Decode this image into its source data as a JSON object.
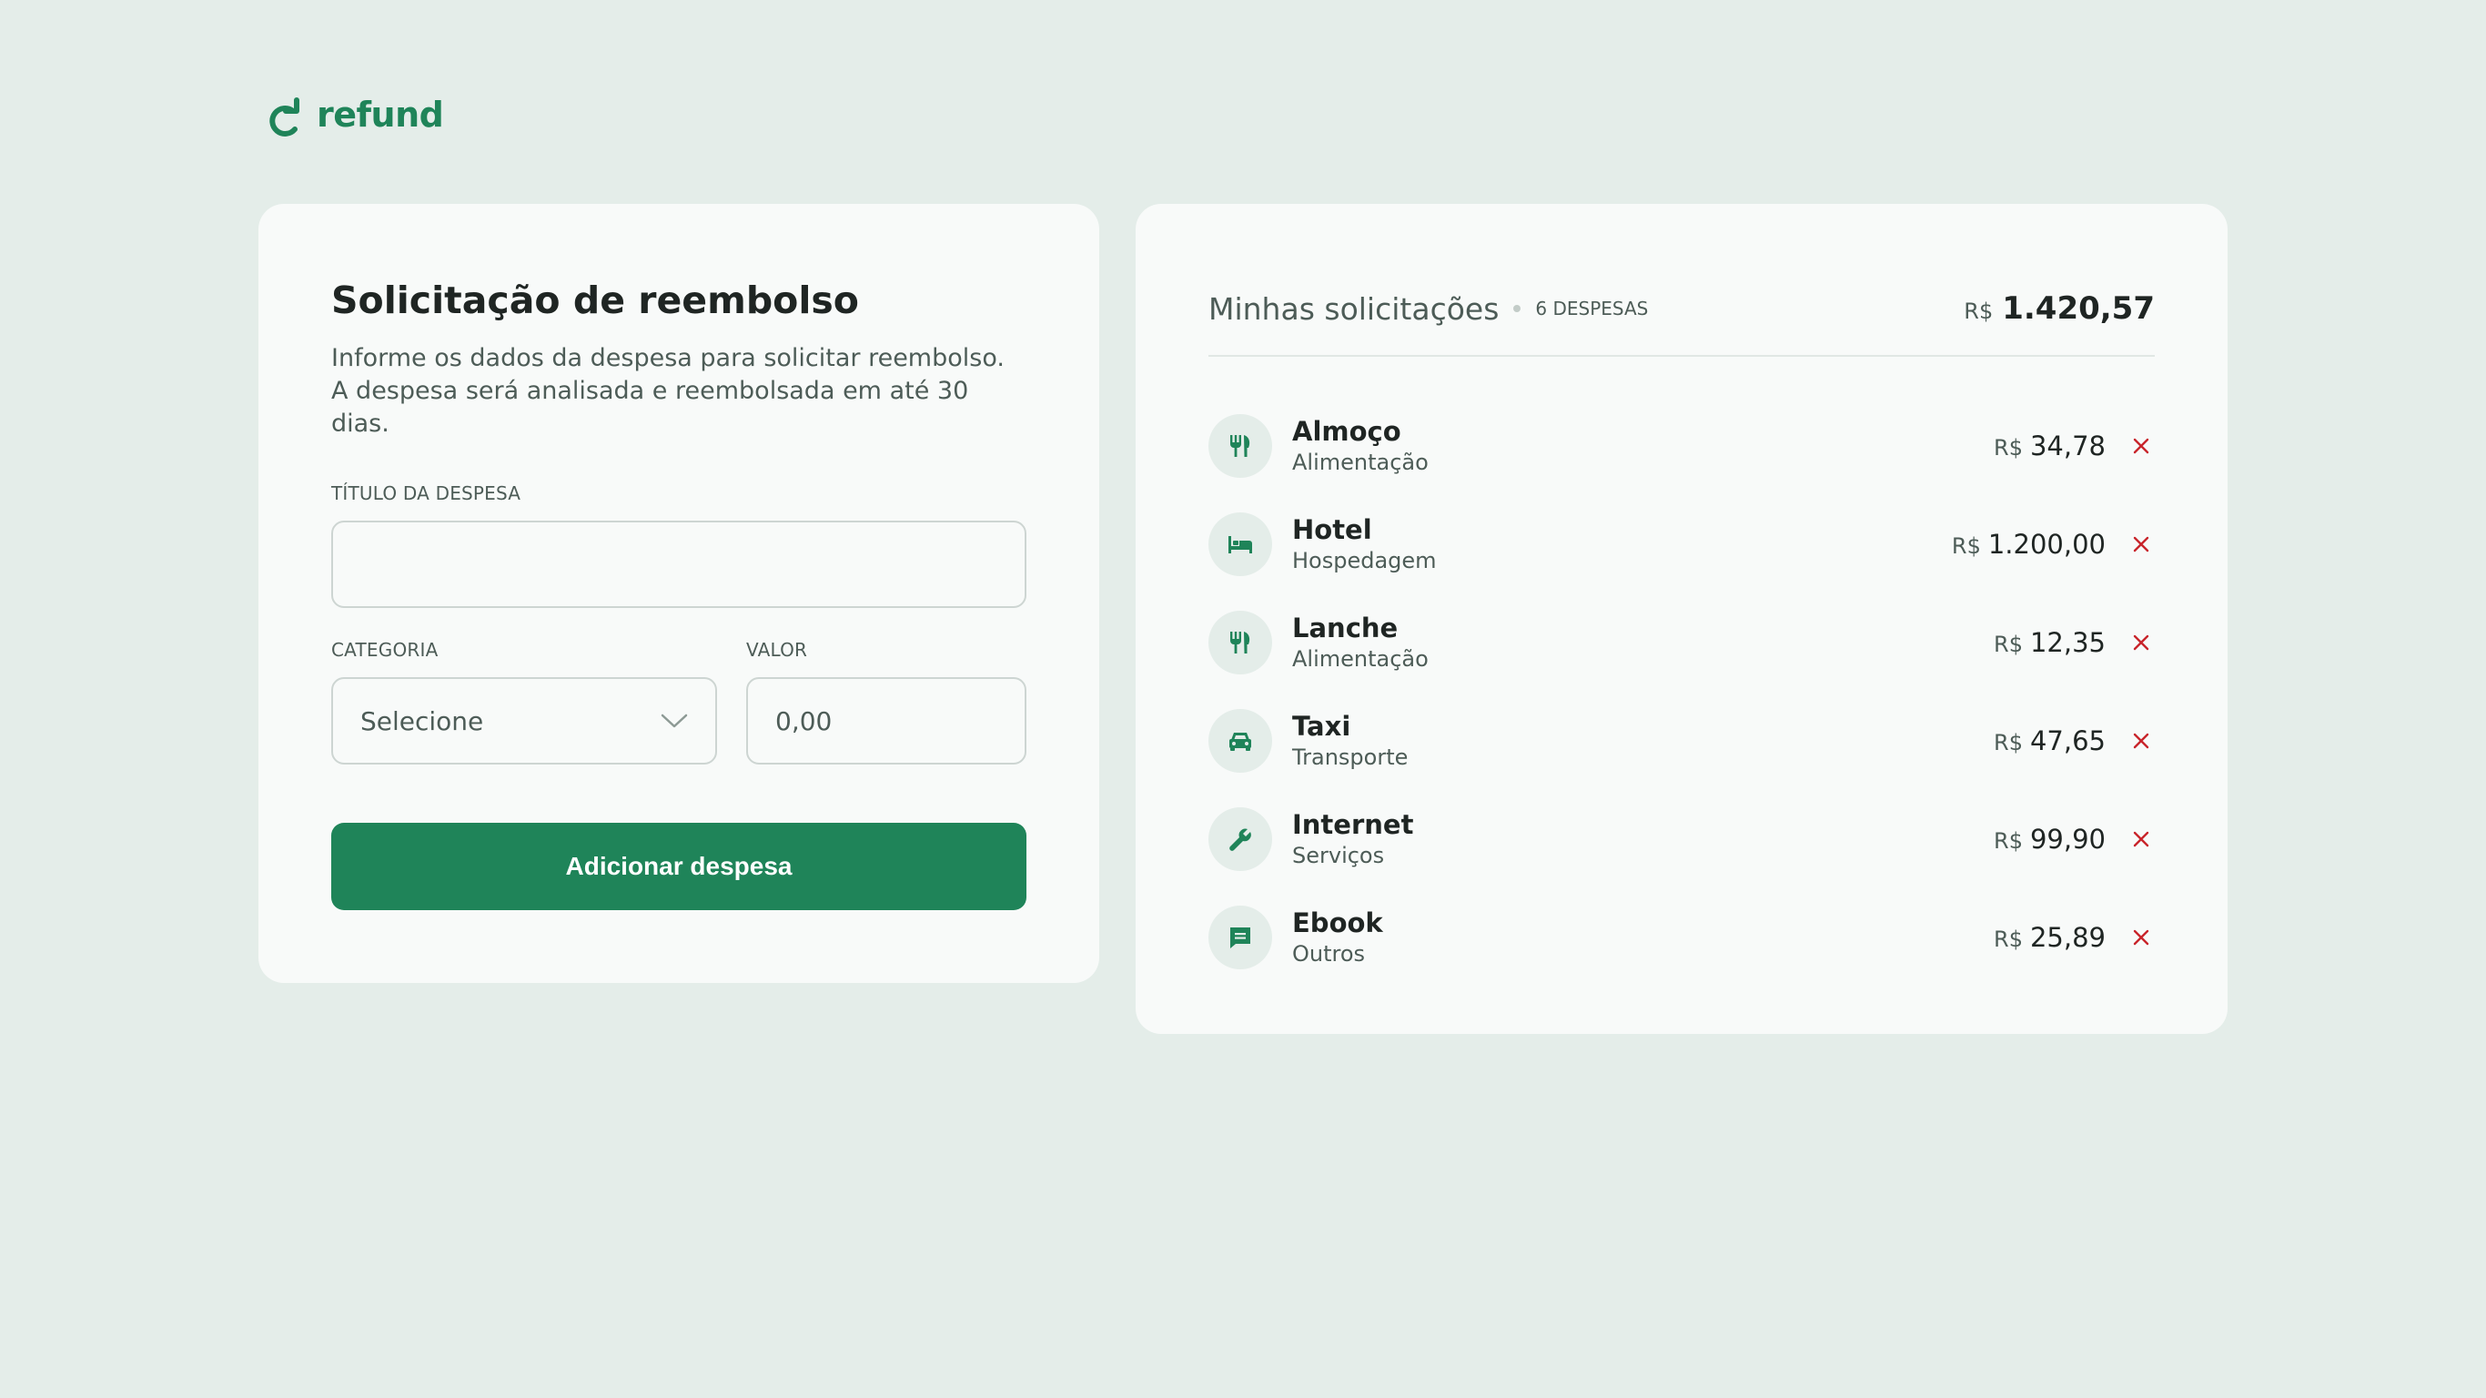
{
  "brand": {
    "name": "refund",
    "color": "#1f8459"
  },
  "form": {
    "title": "Solicitação de reembolso",
    "description_line1": "Informe os dados da despesa para solicitar reembolso.",
    "description_line2": "A despesa será analisada e reembolsada em até 30 dias.",
    "title_label": "TÍTULO DA DESPESA",
    "title_value": "",
    "category_label": "CATEGORIA",
    "category_value": "Selecione",
    "value_label": "VALOR",
    "value_placeholder": "0,00",
    "submit_label": "Adicionar despesa"
  },
  "list": {
    "title": "Minhas solicitações",
    "count": "6 DESPESAS",
    "currency": "R$",
    "total": "1.420,57",
    "items": [
      {
        "name": "Almoço",
        "category": "Alimentação",
        "currency": "R$",
        "amount": "34,78",
        "icon": "food-icon"
      },
      {
        "name": "Hotel",
        "category": "Hospedagem",
        "currency": "R$",
        "amount": "1.200,00",
        "icon": "bed-icon"
      },
      {
        "name": "Lanche",
        "category": "Alimentação",
        "currency": "R$",
        "amount": "12,35",
        "icon": "food-icon"
      },
      {
        "name": "Taxi",
        "category": "Transporte",
        "currency": "R$",
        "amount": "47,65",
        "icon": "car-icon"
      },
      {
        "name": "Internet",
        "category": "Serviços",
        "currency": "R$",
        "amount": "99,90",
        "icon": "wrench-icon"
      },
      {
        "name": "Ebook",
        "category": "Outros",
        "currency": "R$",
        "amount": "25,89",
        "icon": "receipt-icon"
      }
    ]
  },
  "colors": {
    "accent": "#1f8459",
    "danger": "#c8242b",
    "background": "#e4ede9",
    "card": "#f8faf9"
  }
}
